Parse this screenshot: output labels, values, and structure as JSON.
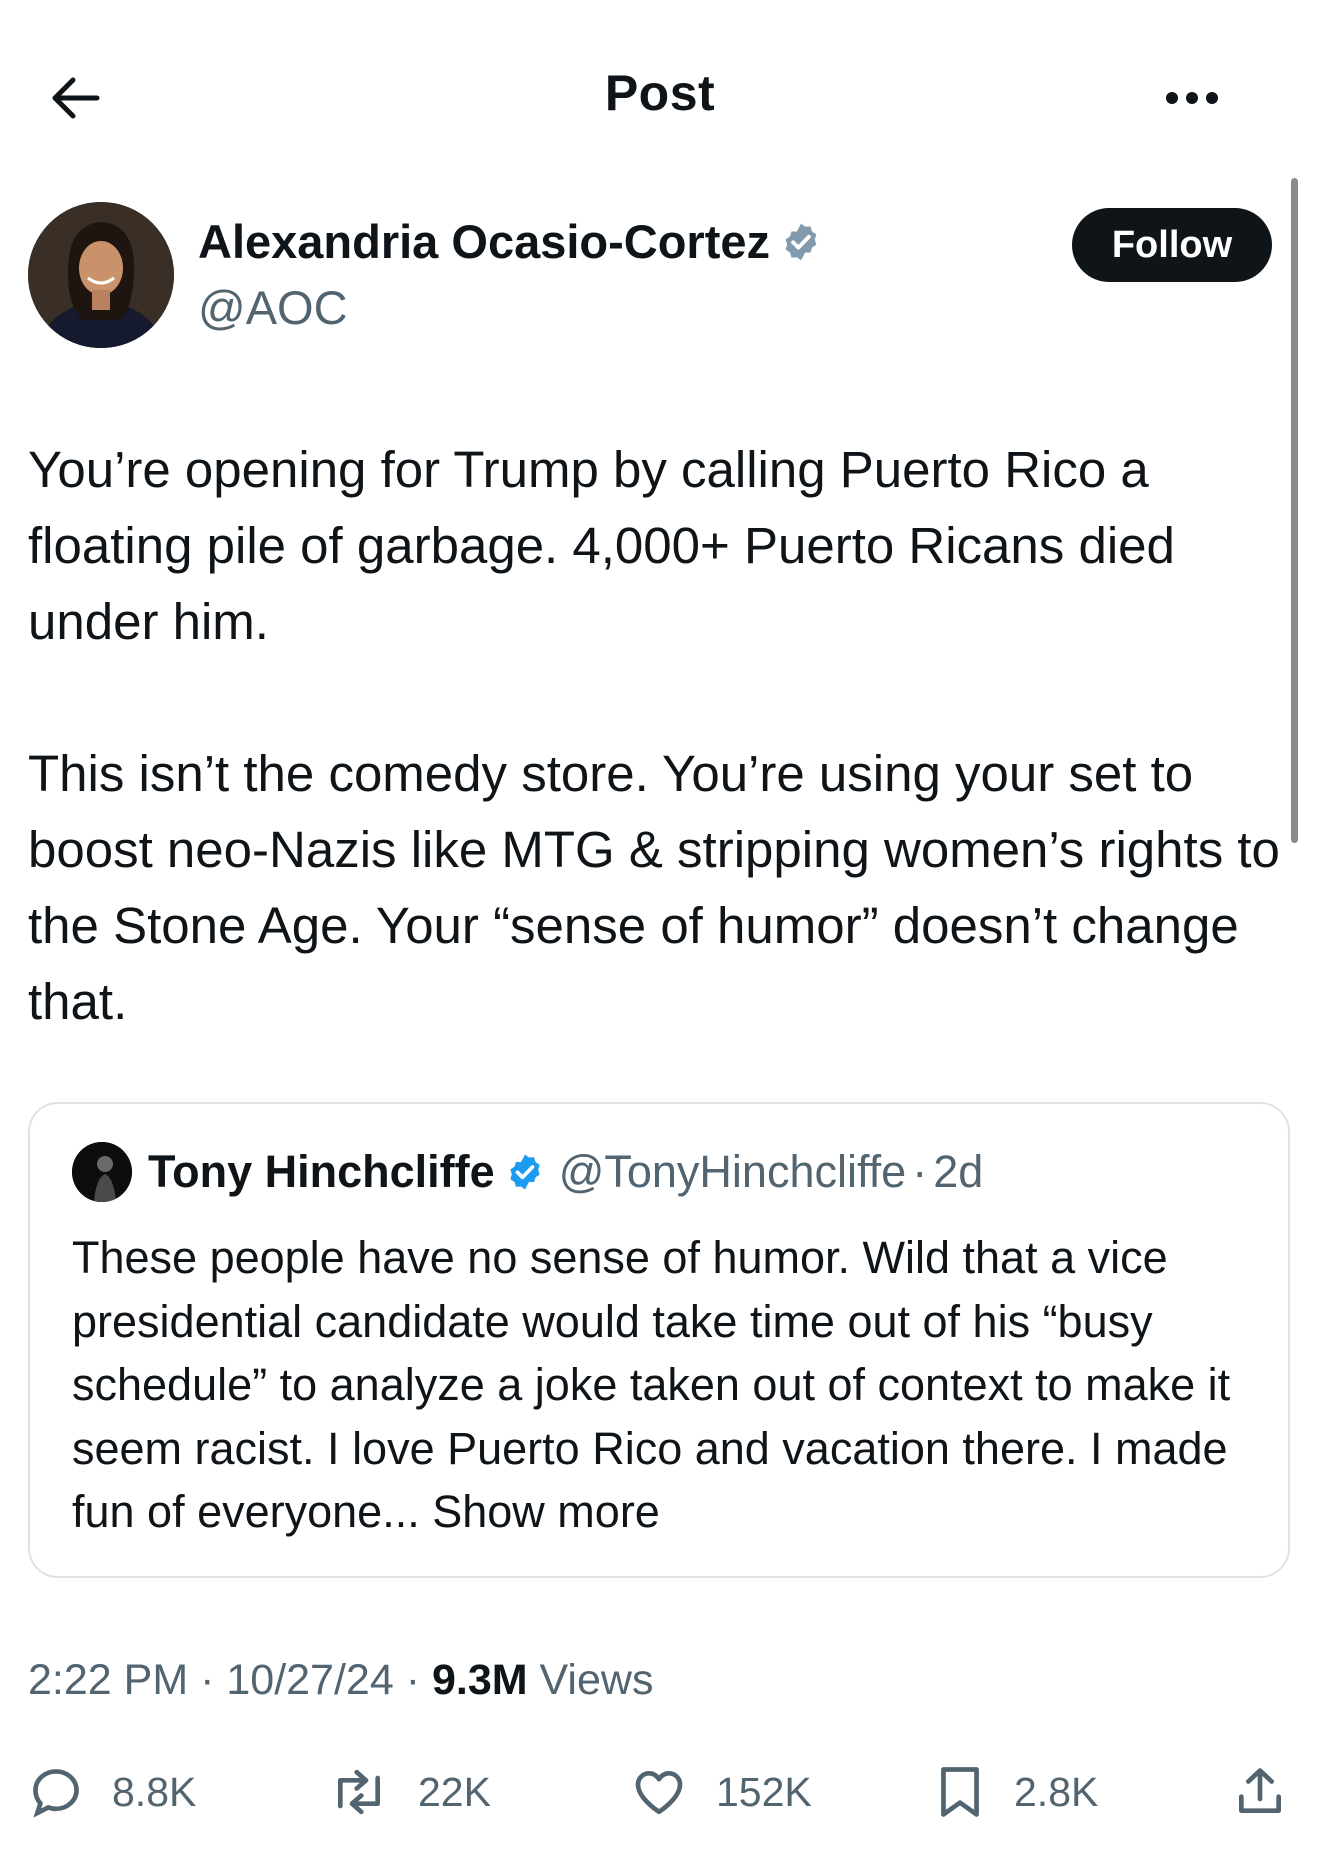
{
  "header": {
    "title": "Post"
  },
  "author": {
    "name": "Alexandria Ocasio-Cortez",
    "handle": "@AOC",
    "follow_label": "Follow",
    "badge_color": "#829aab"
  },
  "tweet": {
    "paragraphs": [
      "You’re opening for Trump by calling Puerto Rico a floating pile of garbage. 4,000+ Puerto Ricans died under him.",
      "This isn’t the comedy store. You’re using your set to boost neo-Nazis like MTG & stripping women’s rights to the Stone Age. Your “sense of humor” doesn’t change that."
    ]
  },
  "quote": {
    "name": "Tony Hinchcliffe",
    "handle": "@TonyHinchcliffe",
    "separator": "·",
    "time": "2d",
    "badge_color": "#1d9bf0",
    "text": "These people have no sense of humor. Wild that a vice presidential candidate would take time out of his “busy schedule” to analyze a joke taken out of context to make it seem racist. I love Puerto Rico and vacation there. I made fun of everyone... ",
    "show_more": "Show more"
  },
  "meta": {
    "time": "2:22 PM",
    "sep1": " · ",
    "date": "10/27/24",
    "sep2": " · ",
    "views_count": "9.3M",
    "views_label": " Views"
  },
  "actions": {
    "replies": "8.8K",
    "reposts": "22K",
    "likes": "152K",
    "bookmarks": "2.8K"
  },
  "colors": {
    "text_primary": "#0f1419",
    "text_secondary": "#536471",
    "border": "#dfe3e6"
  }
}
